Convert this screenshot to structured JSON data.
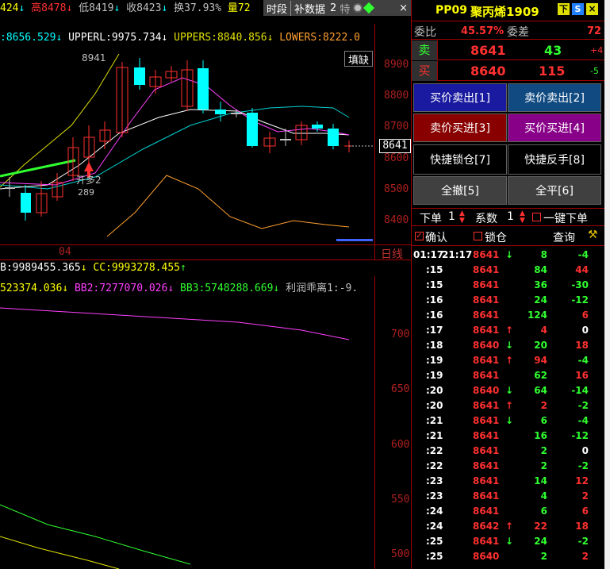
{
  "infobar": {
    "prefix": "424",
    "high_label": "高",
    "high": "8478",
    "low_label": "低",
    "low": "8419",
    "close_label": "收",
    "close": "8423",
    "turnover_label": "换",
    "turnover": "37.93%",
    "volume_label": "量",
    "volume": "72",
    "menu_period": "时段",
    "menu_fill": "补数据",
    "menu_tail": "2",
    "menu_tail2": "特",
    "close_icon_char": "×"
  },
  "ind1": {
    "mid": ":8656.529",
    "upperl": "UPPERL:9975.734",
    "uppers": "UPPERS:8840.856",
    "lowers": "LOWERS:8222.0"
  },
  "ind2": {
    "b": "B:9989455.365",
    "cc": "CC:9993278.455"
  },
  "ind3": {
    "bb1": "523374.036",
    "bb2": "BB2:7277070.026",
    "bb3": "BB3:5748288.669",
    "profit": "利润乖离1:-9."
  },
  "chart": {
    "fill_label": "填缺",
    "price_now": "8641",
    "peak_label": "8941",
    "date_label": "04",
    "period_label": "日线",
    "signal_label": "开多2",
    "signal_value": "289",
    "price_ticks": [
      "8900",
      "8800",
      "8700",
      "8600",
      "8500",
      "8400"
    ],
    "vol_ticks": [
      "700",
      "650",
      "600",
      "550",
      "500"
    ]
  },
  "colors": {
    "up": "#ff3030",
    "down": "#00ffff",
    "mid": "#ff40ff",
    "yellow": "#e0e000",
    "cyan": "#00d0d0",
    "green": "#30ff30",
    "axis": "#b02020"
  },
  "panel": {
    "contract": "PP09",
    "name": "聚丙烯1909",
    "btn_down": "下",
    "btn_info": "S",
    "btn_x": "×",
    "weibi_label": "委比",
    "weibi": "45.57%",
    "weicha_label": "委差",
    "weicha": "72",
    "sell_label": "卖",
    "sell_price": "8641",
    "sell_vol": "43",
    "sell_chg": "+4",
    "buy_label": "买",
    "buy_price": "8640",
    "buy_vol": "115",
    "buy_chg": "-5",
    "b_buy_sell_close": "买价卖出[1]",
    "b_sell_sell_close": "卖价卖出[2]",
    "b_sell_buy_open": "卖价买进[3]",
    "b_buy_buy_open": "买价买进[4]",
    "b_lock": "快捷锁仓[7]",
    "b_reverse": "快捷反手[8]",
    "b_cancel": "全撤[5]",
    "b_close": "全平[6]",
    "order_label": "下单",
    "order_qty": "1",
    "coef_label": "系数",
    "coef_val": "1",
    "one_key_label": "一键下单",
    "confirm_label": "确认",
    "lock_label": "锁仓",
    "query_label": "查询"
  },
  "ticks": [
    {
      "t": "01:17",
      "t2": "21:17",
      "p": "8641",
      "d": "↓",
      "v": "8",
      "c": "-4"
    },
    {
      "t": ":15",
      "p": "8641",
      "d": "",
      "v": "84",
      "c": "44"
    },
    {
      "t": ":15",
      "p": "8641",
      "d": "",
      "v": "36",
      "c": "-30"
    },
    {
      "t": ":16",
      "p": "8641",
      "d": "",
      "v": "24",
      "c": "-12"
    },
    {
      "t": ":16",
      "p": "8641",
      "d": "",
      "v": "124",
      "c": "6"
    },
    {
      "t": ":17",
      "p": "8641",
      "d": "↑",
      "v": "4",
      "c": "0"
    },
    {
      "t": ":18",
      "p": "8640",
      "d": "↓",
      "v": "20",
      "c": "18"
    },
    {
      "t": ":19",
      "p": "8641",
      "d": "↑",
      "v": "94",
      "c": "-4"
    },
    {
      "t": ":19",
      "p": "8641",
      "d": "",
      "v": "62",
      "c": "16"
    },
    {
      "t": ":20",
      "p": "8640",
      "d": "↓",
      "v": "64",
      "c": "-14"
    },
    {
      "t": ":20",
      "p": "8641",
      "d": "↑",
      "v": "2",
      "c": "-2"
    },
    {
      "t": ":21",
      "p": "8641",
      "d": "↓",
      "v": "6",
      "c": "-4"
    },
    {
      "t": ":21",
      "p": "8641",
      "d": "",
      "v": "16",
      "c": "-12"
    },
    {
      "t": ":22",
      "p": "8641",
      "d": "",
      "v": "2",
      "c": "0"
    },
    {
      "t": ":22",
      "p": "8641",
      "d": "",
      "v": "2",
      "c": "-2"
    },
    {
      "t": ":23",
      "p": "8641",
      "d": "",
      "v": "14",
      "c": "12"
    },
    {
      "t": ":23",
      "p": "8641",
      "d": "",
      "v": "4",
      "c": "2"
    },
    {
      "t": ":24",
      "p": "8641",
      "d": "",
      "v": "6",
      "c": "6"
    },
    {
      "t": ":24",
      "p": "8642",
      "d": "↑",
      "v": "22",
      "c": "18"
    },
    {
      "t": ":25",
      "p": "8641",
      "d": "↓",
      "v": "24",
      "c": "-2"
    },
    {
      "t": ":25",
      "p": "8640",
      "d": "",
      "v": "2",
      "c": "2"
    }
  ]
}
